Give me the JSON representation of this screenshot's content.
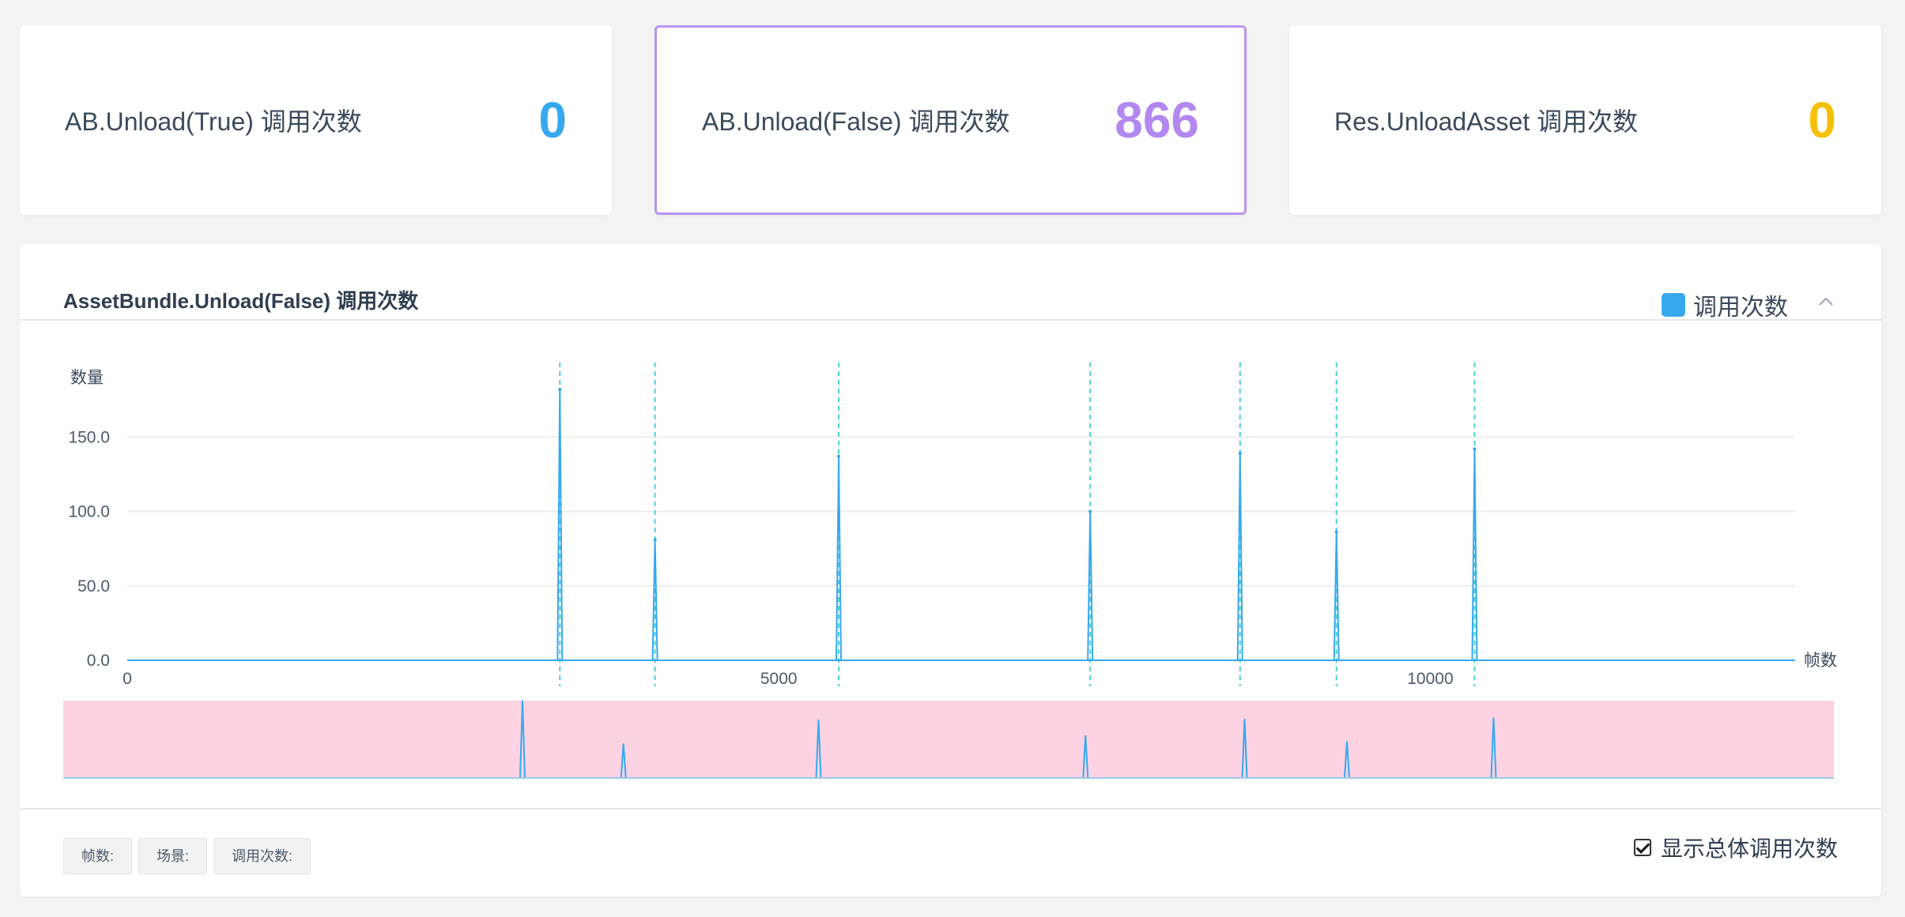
{
  "stats": [
    {
      "label": "AB.Unload(True) 调用次数",
      "value": "0",
      "color": "#36a9ee",
      "active": false
    },
    {
      "label": "AB.Unload(False) 调用次数",
      "value": "866",
      "color": "#b388f0",
      "active": true
    },
    {
      "label": "Res.UnloadAsset 调用次数",
      "value": "0",
      "color": "#f6c00a",
      "active": false
    }
  ],
  "panel": {
    "title": "AssetBundle.Unload(False) 调用次数",
    "collapse_icon": "chevron-up-icon",
    "legend": {
      "label": "调用次数",
      "color": "#36a9ee"
    }
  },
  "chart_data": {
    "type": "line",
    "ylabel": "数量",
    "xlabel": "帧数",
    "yticks": [
      0,
      50,
      100,
      150
    ],
    "ytick_labels": [
      "0.0",
      "50.0",
      "100.0",
      "150.0"
    ],
    "ylim": [
      0,
      200
    ],
    "xticks": [
      0,
      5000,
      10000
    ],
    "xtick_labels": [
      "0",
      "5000",
      "10000"
    ],
    "xlim": [
      0,
      12800
    ],
    "grid": true,
    "line_color": "#36a9ee",
    "marker_line_color": "#4dd0d6",
    "series": [
      {
        "name": "调用次数",
        "x": [
          3320,
          4050,
          5460,
          7390,
          8540,
          9280,
          10340
        ],
        "y": [
          182,
          81,
          137,
          100,
          139,
          86,
          142
        ]
      }
    ],
    "dataZoom": {
      "background": "#fdd3e4",
      "range": [
        0,
        100
      ]
    }
  },
  "footer": {
    "tags": [
      "帧数:",
      "场景:",
      "调用次数:"
    ],
    "toggle_label": "显示总体调用次数",
    "toggle_checked": true
  }
}
